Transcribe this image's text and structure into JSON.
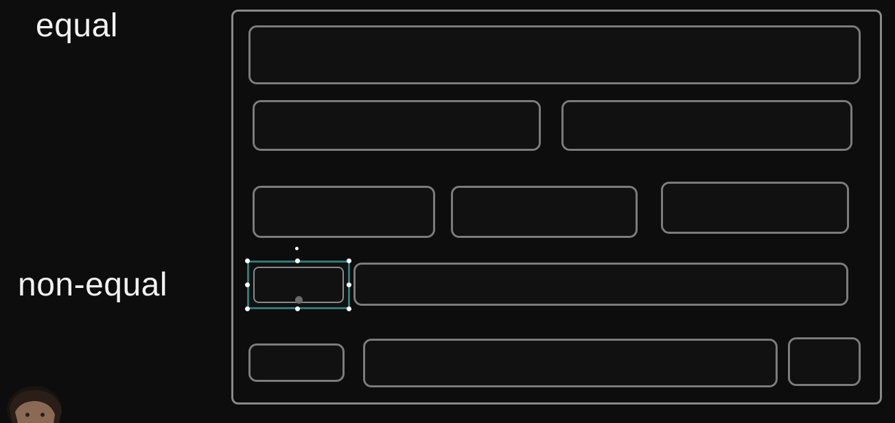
{
  "labels": {
    "equal": "equal",
    "non_equal": "non-equal"
  },
  "colors": {
    "background": "#0d0d0d",
    "box_border": "#7c7c7c",
    "selection": "#2f7a78",
    "text": "#f2f2f2"
  },
  "rows": [
    {
      "group": "equal",
      "count": 1
    },
    {
      "group": "equal",
      "count": 2
    },
    {
      "group": "equal",
      "count": 3
    },
    {
      "group": "non-equal",
      "count": 2
    },
    {
      "group": "non-equal",
      "count": 3
    }
  ],
  "selection": {
    "row": 4,
    "box": 1,
    "state": "selected"
  }
}
